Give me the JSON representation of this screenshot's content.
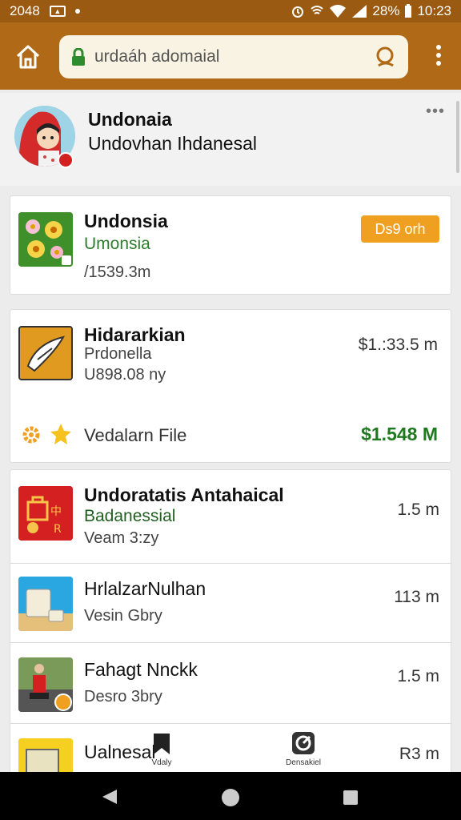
{
  "status": {
    "time_left": "2048",
    "battery": "28%",
    "clock": "10:23"
  },
  "toolbar": {
    "url": "urdaáh adomaial"
  },
  "profile": {
    "name": "Undonaia",
    "subtitle": "Undovhan Ihdanesal",
    "more": "•••"
  },
  "items": [
    {
      "title": "Undonsia",
      "subtitle": "Umonsia",
      "meta": "/1539.3m",
      "button": "Ds9 orh"
    },
    {
      "title": "Hidararkian",
      "subtitle": "Prdonella",
      "meta": "U898.08 ny",
      "price": "$1.:33.5 m",
      "footer_label": "Vedalarn File",
      "footer_value": "$1.548 M",
      "footer_color": "#1f7a1f"
    },
    {
      "title": "Undoratatis Antahaical",
      "subtitle": "Badanessial",
      "meta": "Veam 3:zy",
      "price": "1.5 m"
    },
    {
      "title": "HrlalzarNulhan",
      "meta": "Vesin Gbry",
      "price": "113 m"
    },
    {
      "title": "Fahagt Nnckk",
      "meta": "Desro 3bry",
      "price": "1.5 m"
    },
    {
      "title": "Ualnesal",
      "price": "R3 m"
    }
  ],
  "bottom_tabs": [
    {
      "label": "Vdaly",
      "icon": "bookmark-icon"
    },
    {
      "label": "Densakiel",
      "icon": "compass-icon"
    }
  ],
  "colors": {
    "toolbar": "#b06a17",
    "status_bar": "#9a5a12",
    "accent_orange": "#f0a020",
    "green": "#2e7d2e"
  }
}
